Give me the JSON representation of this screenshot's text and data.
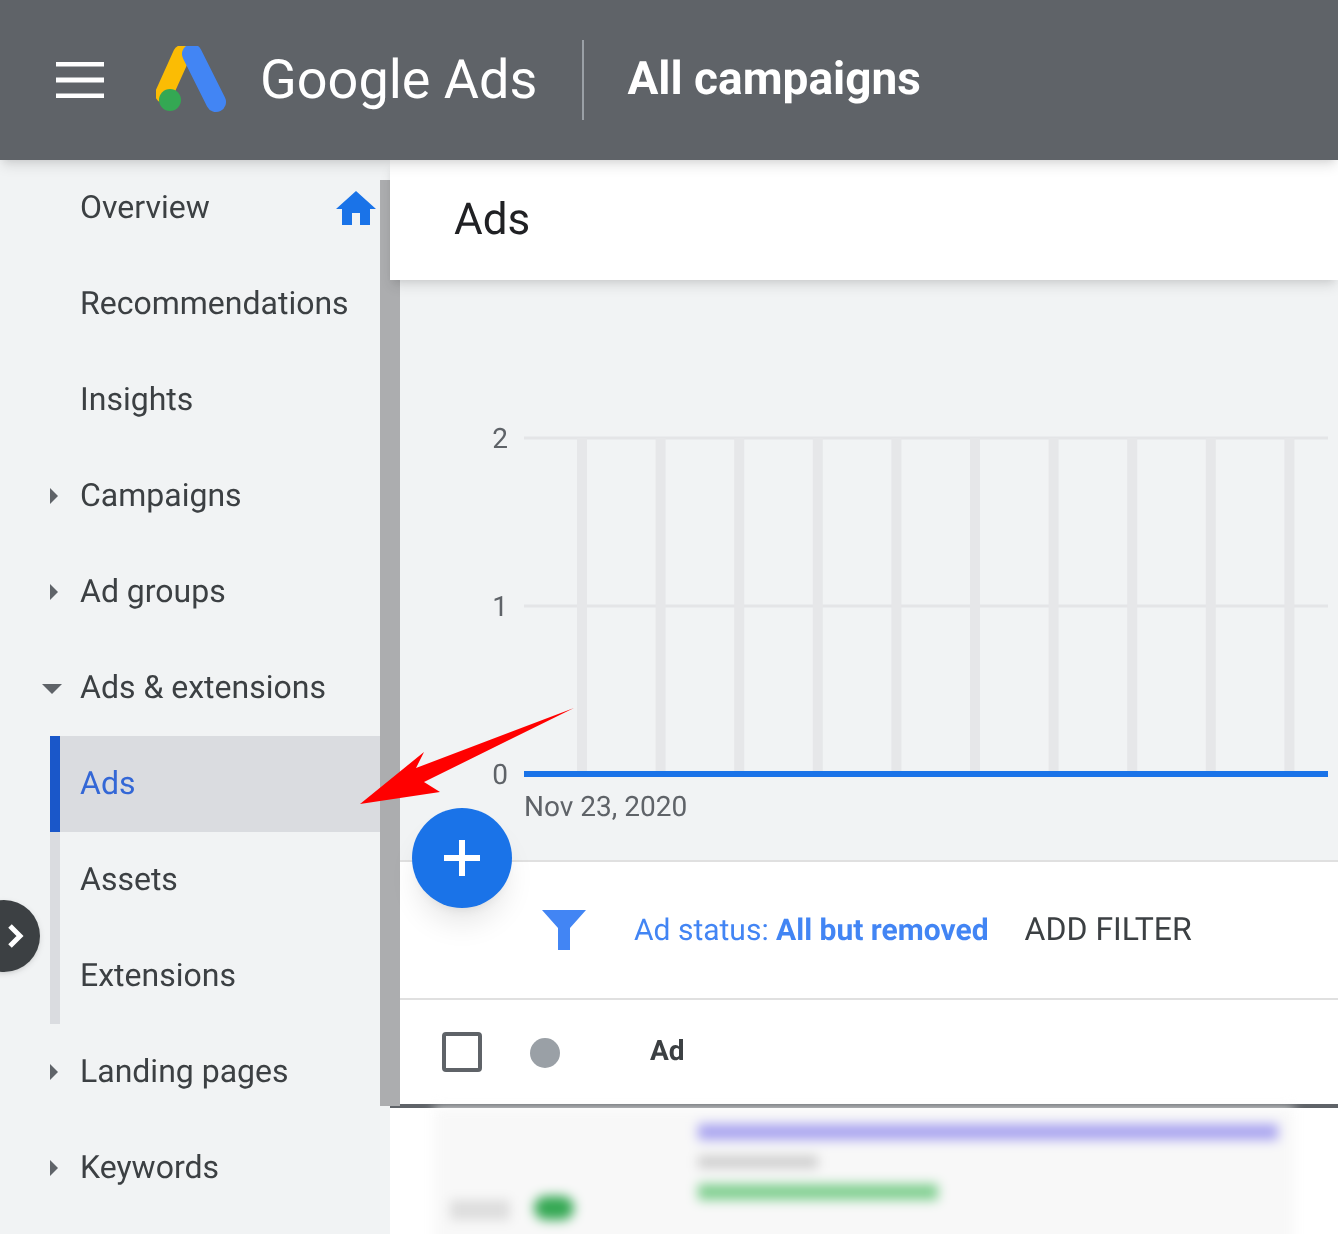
{
  "header": {
    "product": "Google Ads",
    "title": "All campaigns"
  },
  "sidebar": {
    "items": [
      {
        "label": "Overview",
        "kind": "home"
      },
      {
        "label": "Recommendations",
        "kind": "plain"
      },
      {
        "label": "Insights",
        "kind": "plain"
      },
      {
        "label": "Campaigns",
        "kind": "group",
        "expanded": false
      },
      {
        "label": "Ad groups",
        "kind": "group",
        "expanded": false
      },
      {
        "label": "Ads & extensions",
        "kind": "group",
        "expanded": true,
        "children": [
          {
            "label": "Ads",
            "selected": true
          },
          {
            "label": "Assets",
            "selected": false
          },
          {
            "label": "Extensions",
            "selected": false
          }
        ]
      },
      {
        "label": "Landing pages",
        "kind": "group",
        "expanded": false
      },
      {
        "label": "Keywords",
        "kind": "group",
        "expanded": false
      }
    ]
  },
  "page": {
    "title": "Ads"
  },
  "chart": {
    "y_axis_labels": [
      "2",
      "1",
      "0"
    ],
    "x_axis_label": "Nov 23, 2020"
  },
  "filter": {
    "label": "Ad status: ",
    "value": "All but removed",
    "add": "ADD FILTER"
  },
  "table": {
    "select_all": {
      "checked": false
    },
    "columns": [
      "Ad"
    ]
  }
}
